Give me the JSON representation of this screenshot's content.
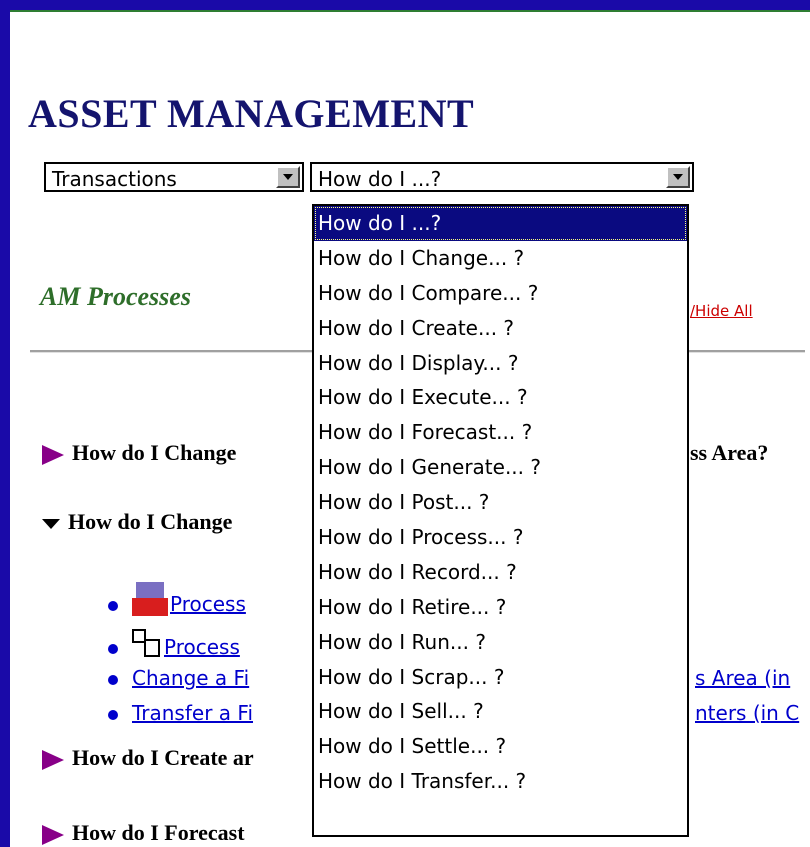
{
  "title": "ASSET MANAGEMENT",
  "selects": {
    "transactions": "Transactions",
    "how": "How do I ...?"
  },
  "section_label": "AM Processes",
  "show_hide": "/Hide All",
  "headings": {
    "h1": "How do I Change",
    "h1_tail": "ss Area?",
    "h2": "How do I Change",
    "h3": "How do I Create ar",
    "h4": "How do I Forecast"
  },
  "bullets": {
    "b1": "Process",
    "b2": "Process",
    "b3": "Change a Fi",
    "b3_tail": "s Area (in",
    "b4": "Transfer a Fi",
    "b4_tail": "nters (in C"
  },
  "dropdown": {
    "options": [
      "How do I ...?",
      "How do I Change... ?",
      "How do I Compare... ?",
      "How do I Create... ?",
      "How do I Display... ?",
      "How do I Execute... ?",
      "How do I Forecast... ?",
      "How do I Generate... ?",
      "How do I Post... ?",
      "How do I Process... ?",
      "How do I Record... ?",
      "How do I Retire... ?",
      "How do I Run... ?",
      "How do I Scrap... ?",
      "How do I Sell... ?",
      "How do I Settle... ?",
      "How do I Transfer... ?"
    ],
    "selected_index": 0
  },
  "colors": {
    "outer_frame": "#1a0aa8",
    "title": "#14146e",
    "section_label": "#2e6e2a",
    "selection": "#0a0a80",
    "link": "#0000cc",
    "expand_arrow": "#880088"
  },
  "icons": [
    "expand-arrow-icon",
    "collapse-arrow-icon",
    "bullet-icon",
    "transaction-icon",
    "process-tree-icon",
    "dropdown-arrow-icon"
  ]
}
